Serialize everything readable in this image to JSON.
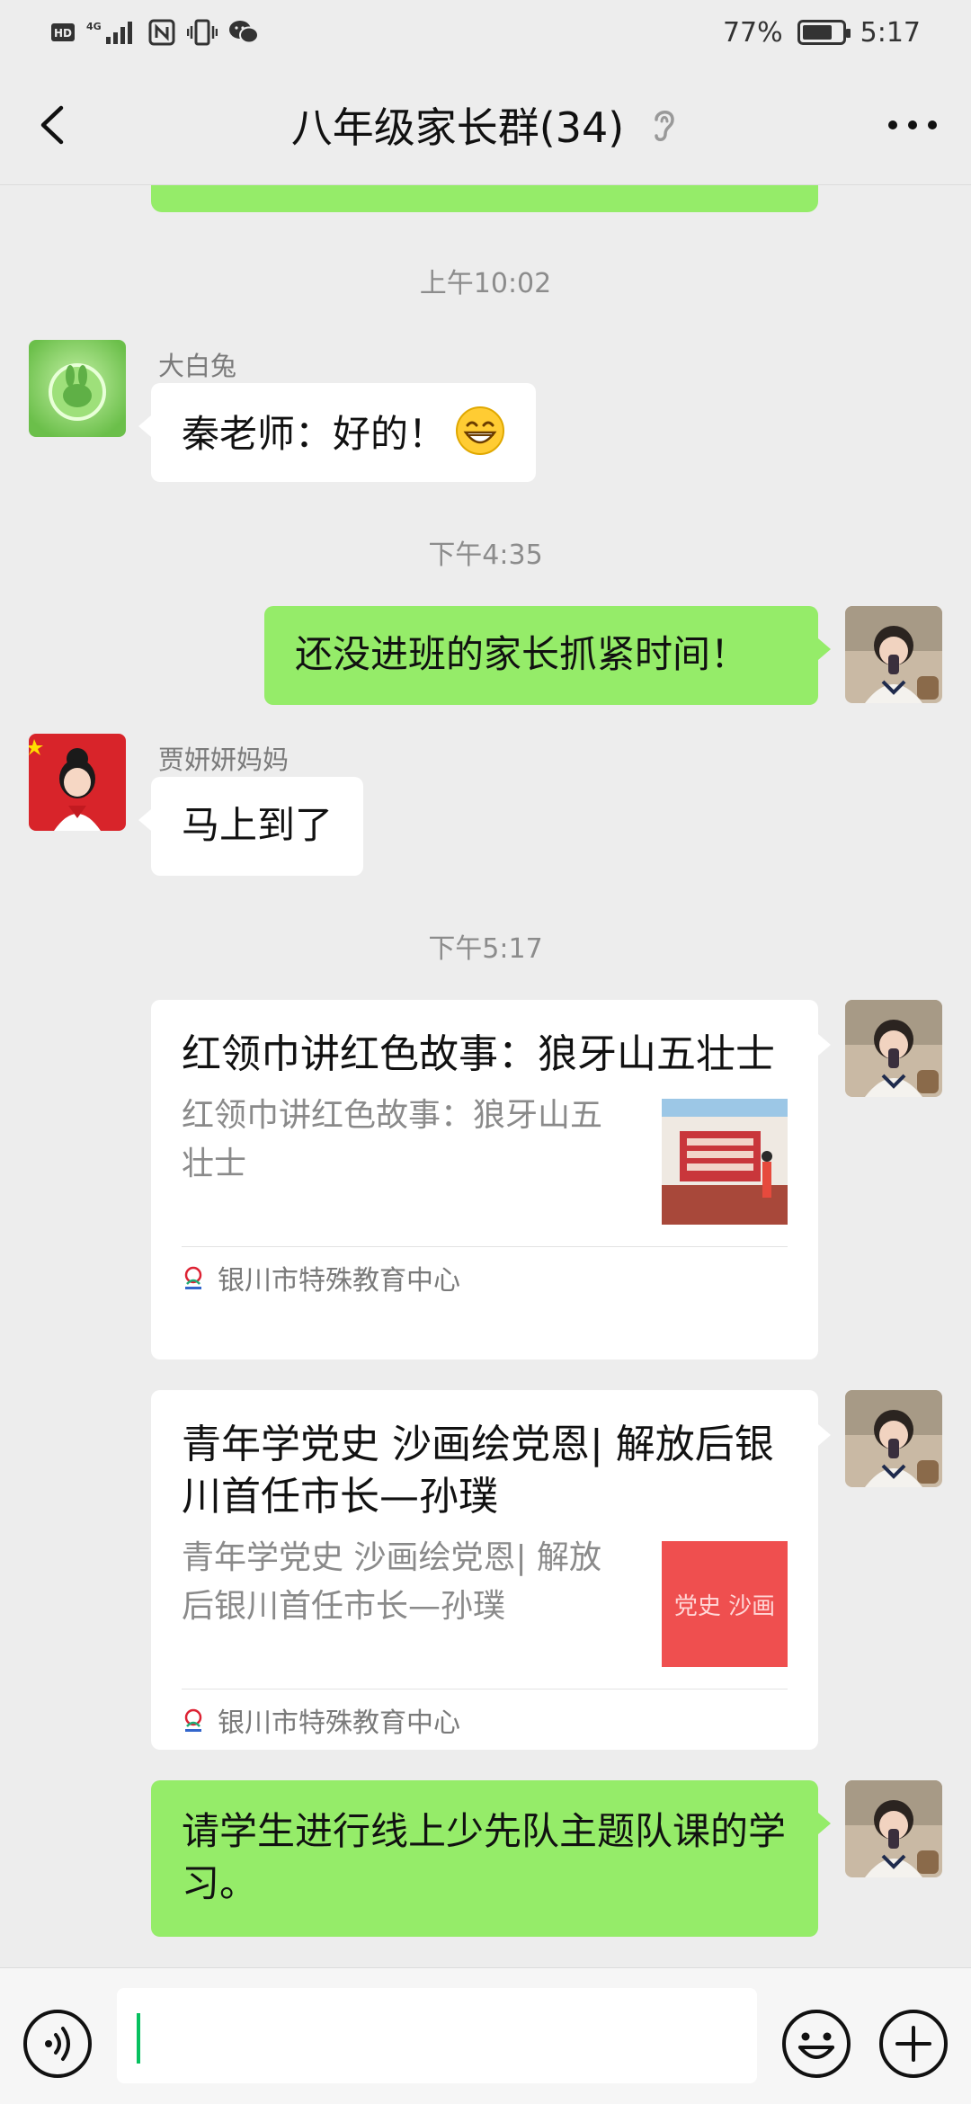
{
  "status_bar": {
    "left_icons": [
      "hd-icon",
      "4g-signal-icon",
      "nfc-icon",
      "vibrate-icon",
      "wechat-notification-icon"
    ],
    "battery_text": "77%",
    "battery_level": 0.77,
    "time": "5:17"
  },
  "header": {
    "title": "八年级家长群(34)"
  },
  "messages": {
    "time_1": "上午10:02",
    "msg_1": {
      "sender": "大白兔",
      "text": "秦老师：好的！",
      "emoji": "grinning-face"
    },
    "time_2": "下午4:35",
    "msg_2": {
      "text": "还没进班的家长抓紧时间！"
    },
    "msg_3": {
      "sender": "贾妍妍妈妈",
      "text": "马上到了"
    },
    "time_3": "下午5:17",
    "card_1": {
      "title": "红领巾讲红色故事：狼牙山五壮士",
      "desc": "红领巾讲红色故事：狼牙山五壮士",
      "source": "银川市特殊教育中心"
    },
    "card_2": {
      "title": "青年学党史 沙画绘党恩| 解放后银川首任市长—孙璞",
      "desc": "青年学党史 沙画绘党恩| 解放后银川首任市长—孙璞",
      "thumb_text": "党史 沙画",
      "source": "银川市特殊教育中心"
    },
    "msg_4": {
      "text": "请学生进行线上少先队主题队课的学习。"
    }
  },
  "input_bar": {
    "value": ""
  },
  "colors": {
    "background": "#ededed",
    "bubble_green": "#95ec69",
    "bubble_white": "#ffffff",
    "cursor": "#07c160"
  }
}
